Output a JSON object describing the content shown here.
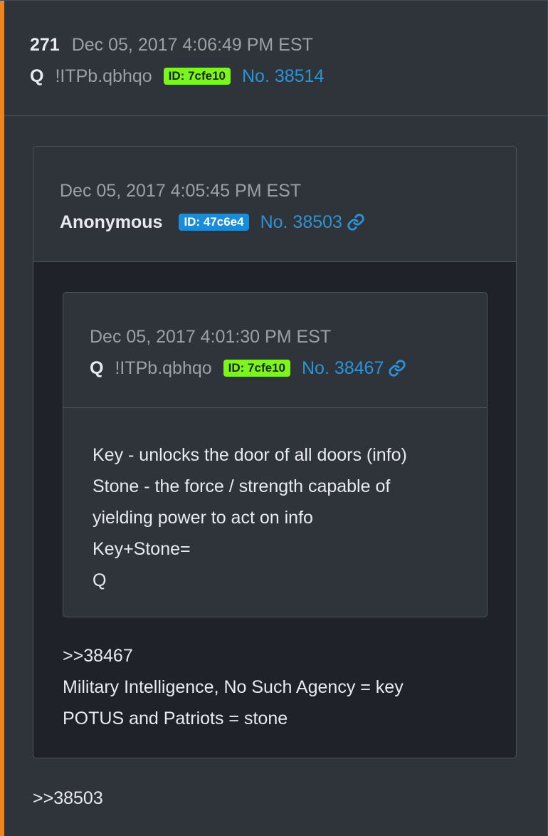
{
  "post": {
    "number": "271",
    "date": "Dec 05, 2017 4:06:49 PM EST",
    "name": "Q",
    "trip": "!ITPb.qbhqo",
    "id": "ID: 7cfe10",
    "post_no": "No. 38514",
    "body": [
      ">>38503"
    ]
  },
  "quote1": {
    "date": "Dec 05, 2017 4:05:45 PM EST",
    "name": "Anonymous",
    "id": "ID: 47c6e4",
    "post_no": "No. 38503",
    "body": [
      ">>38467",
      "Military Intelligence, No Such Agency = key",
      "POTUS and Patriots = stone"
    ]
  },
  "quote2": {
    "date": "Dec 05, 2017 4:01:30 PM EST",
    "name": "Q",
    "trip": "!ITPb.qbhqo",
    "id": "ID: 7cfe10",
    "post_no": "No. 38467",
    "body": [
      "Key - unlocks the door of all doors (info)",
      "Stone - the force / strength capable of",
      "yielding power to act on info",
      "Key+Stone=",
      "Q"
    ]
  },
  "colors": {
    "accent": "#f3831c",
    "id_green": "#7cf51f",
    "id_blue": "#1a8cd8",
    "link": "#2b93d6"
  },
  "icons": {
    "permalink": "link-icon"
  }
}
